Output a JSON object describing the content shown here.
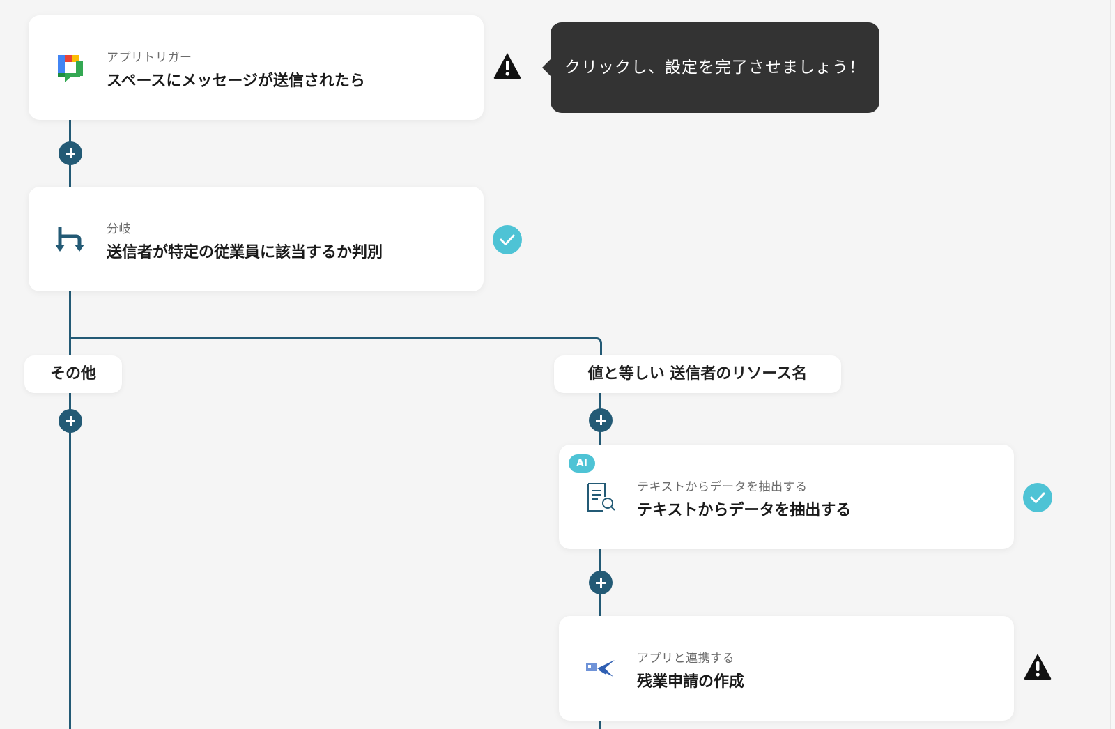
{
  "tooltip": {
    "text": "クリックし、設定を完了させましょう！"
  },
  "steps": {
    "trigger": {
      "sub": "アプリトリガー",
      "title": "スペースにメッセージが送信されたら",
      "icon": "google-chat-icon",
      "status": "warning"
    },
    "branch": {
      "sub": "分岐",
      "title": "送信者が特定の従業員に該当するか判別",
      "icon": "branch-icon",
      "status": "complete"
    },
    "extract": {
      "badge": "AI",
      "sub": "テキストからデータを抽出する",
      "title": "テキストからデータを抽出する",
      "icon": "document-search-icon",
      "status": "complete"
    },
    "overtime": {
      "sub": "アプリと連携する",
      "title": "残業申請の作成",
      "icon": "plane-app-icon",
      "status": "warning"
    }
  },
  "branches": {
    "other": "その他",
    "match": "値と等しい 送信者のリソース名"
  },
  "colors": {
    "flow": "#235a75",
    "check": "#4ec3d5",
    "tooltip_bg": "#333333"
  }
}
